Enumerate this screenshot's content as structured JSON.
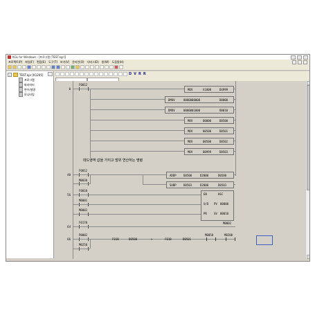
{
  "window": {
    "title": "KGL for Windows - [프로그램 [TEST.kgr]]"
  },
  "menu": [
    "프로젝트(P)",
    "파일(F)",
    "편집(E)",
    "도구(T)",
    "보기(V)",
    "온라인(O)",
    "디버그(D)",
    "창(W)",
    "도움말(H)"
  ],
  "toolbar": {
    "tool_letters": [
      "D",
      "V",
      "R",
      "R"
    ]
  },
  "tree": {
    "root": "TEST.kpr [K1205]",
    "items": [
      "프로그램",
      "파라미터",
      "변수/설명",
      "모니터링"
    ]
  },
  "ladder": {
    "steps": [
      "0",
      "40",
      "56",
      "64",
      "66"
    ],
    "contacts": [
      "F0012",
      "F0012",
      "M0030",
      "F0010",
      "M0001",
      "M0002",
      "F0170",
      "P0002",
      "M0250"
    ],
    "comment": "데드영역 값을 가지고 범위 연산하는 명령",
    "instructions": [
      {
        "op": "MOV",
        "a": "h1000",
        "b": "D4999"
      },
      {
        "op": "DMOV",
        "a": "0000000000",
        "b": "D0000"
      },
      {
        "op": "DMOV",
        "a": "0000001000",
        "b": "D0010"
      },
      {
        "op": "MOV",
        "a": "00000",
        "b": "D0500"
      },
      {
        "op": "MOV",
        "a": "00500",
        "b": "D0501"
      },
      {
        "op": "MOV",
        "a": "00500",
        "b": "D0502"
      },
      {
        "op": "MOV",
        "a": "00999",
        "b": "D0503"
      }
    ],
    "addp": {
      "op": "ADDP",
      "a": "D0500",
      "b": "D2000",
      "c": "D0500"
    },
    "subp": {
      "op": "SUBP",
      "a": "D0503",
      "b": "D2000",
      "c": "D0503"
    },
    "hsc": {
      "en": "EN",
      "name": "HSC",
      "uo": "U/D",
      "pv_label": "PV",
      "pv": "00000",
      "pr_label": "PR",
      "sv_label": "SV",
      "sv": "00010"
    },
    "coil_m0002": "M0002",
    "compare": {
      "a": "F018",
      "b": "D0500",
      "op": ">",
      "c": "F018",
      "d": "D0501",
      "coil1": "M0050",
      "coil2": "M0200"
    }
  }
}
